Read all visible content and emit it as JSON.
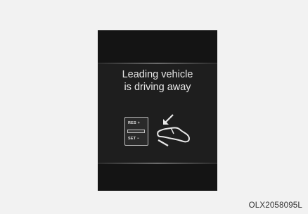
{
  "display": {
    "message_line1": "Leading vehicle",
    "message_line2": "is driving away"
  },
  "switch": {
    "res_label": "RES +",
    "set_label": "SET −"
  },
  "icons": {
    "switch": "cruise-control-lever-icon",
    "pedal": "foot-on-accelerator-icon"
  },
  "figure_code": "OLX2058095L",
  "colors": {
    "screen": "#1e1e1e",
    "text": "#e8e8e8",
    "background": "#f2f2f2"
  }
}
